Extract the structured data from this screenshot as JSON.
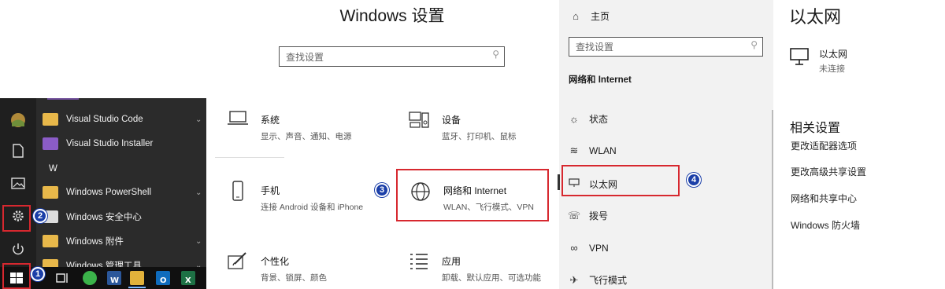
{
  "start_menu": {
    "apps": [
      {
        "label": "Visual Studio Code",
        "icon": "folder-icon",
        "chevron": true
      },
      {
        "label": "Visual Studio Installer",
        "icon": "visual-studio-icon",
        "chevron": false
      },
      {
        "label": "W",
        "icon": "",
        "chevron": false
      },
      {
        "label": "Windows PowerShell",
        "icon": "folder-icon",
        "chevron": true
      },
      {
        "label": "Windows 安全中心",
        "icon": "shield-icon",
        "chevron": false
      },
      {
        "label": "Windows 附件",
        "icon": "folder-icon",
        "chevron": true
      },
      {
        "label": "Windows 管理工具",
        "icon": "folder-icon",
        "chevron": true
      }
    ],
    "rail_icons": [
      "user-avatar-icon",
      "document-icon",
      "pictures-icon",
      "settings-gear-icon",
      "power-icon"
    ],
    "taskbar_icons": [
      "windows-start-icon",
      "task-view-icon",
      "wechat-icon",
      "word-icon",
      "file-explorer-icon",
      "outlook-icon",
      "excel-icon"
    ]
  },
  "badges": [
    "1",
    "2",
    "3",
    "4"
  ],
  "settings_home": {
    "title": "Windows 设置",
    "search_placeholder": "查找设置",
    "tiles": [
      {
        "title": "系统",
        "desc": "显示、声音、通知、电源",
        "icon": "laptop-icon"
      },
      {
        "title": "设备",
        "desc": "蓝牙、打印机、鼠标",
        "icon": "devices-icon"
      },
      {
        "title": "手机",
        "desc": "连接 Android 设备和 iPhone",
        "icon": "phone-icon"
      },
      {
        "title": "网络和 Internet",
        "desc": "WLAN、飞行模式、VPN",
        "icon": "globe-icon"
      },
      {
        "title": "个性化",
        "desc": "背景、锁屏、颜色",
        "icon": "personalization-icon"
      },
      {
        "title": "应用",
        "desc": "卸载、默认应用、可选功能",
        "icon": "apps-list-icon"
      }
    ]
  },
  "nav": {
    "home": "主页",
    "search_placeholder": "查找设置",
    "section": "网络和 Internet",
    "items": [
      {
        "label": "状态",
        "icon": "status-globe-icon"
      },
      {
        "label": "WLAN",
        "icon": "wifi-icon"
      },
      {
        "label": "以太网",
        "icon": "ethernet-icon"
      },
      {
        "label": "拨号",
        "icon": "dialup-icon"
      },
      {
        "label": "VPN",
        "icon": "vpn-icon"
      },
      {
        "label": "飞行模式",
        "icon": "airplane-icon"
      }
    ]
  },
  "ethernet_page": {
    "title": "以太网",
    "connection_name": "以太网",
    "connection_status": "未连接",
    "related_title": "相关设置",
    "related_links": [
      "更改适配器选项",
      "更改高级共享设置",
      "网络和共享中心",
      "Windows 防火墙"
    ]
  },
  "colors": {
    "highlight": "#d7282f",
    "badge": "#1b3fa8",
    "start_bg": "#2b2b2b"
  }
}
